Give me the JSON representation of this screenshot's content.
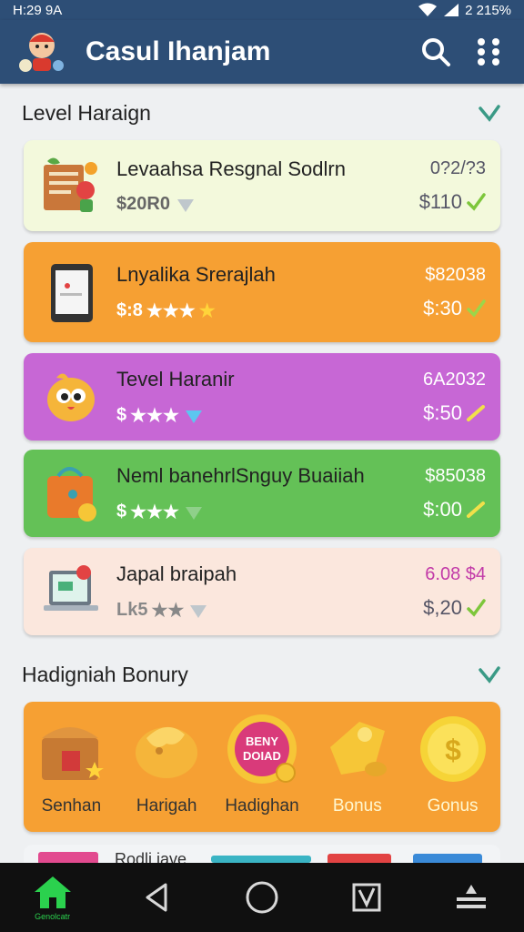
{
  "status": {
    "time": "H:29 9A",
    "battery": "2 215%"
  },
  "app": {
    "title": "Casul Ihanjam",
    "logo_icon": "mascot-logo-icon",
    "search_icon": "search-icon",
    "menu_icon": "more-icon"
  },
  "level_section": {
    "title": "Level Haraign",
    "chevron_icon": "chevron-down-icon"
  },
  "cards": [
    {
      "title": "Levaahsa Resgnal Sodlrn",
      "sub": "$20R0",
      "sub_rating": null,
      "num": "0?2/?3",
      "price": "$110",
      "bg": "#f3f9dc",
      "icon": "clipboard-icon"
    },
    {
      "title": "Lnyalika Srerajlah",
      "sub": "$:8",
      "sub_rating": "★★★",
      "num": "$82038",
      "price": "$:30",
      "bg": "#f6a033",
      "icon": "tablet-icon"
    },
    {
      "title": "Tevel Haranir",
      "sub": "$",
      "sub_rating": "★★★",
      "num": "6A2032",
      "price": "$:50",
      "bg": "#c767d5",
      "icon": "bird-icon"
    },
    {
      "title": "Neml banehrlSnguy Buaiiah",
      "sub": "$",
      "sub_rating": "★★★",
      "num": "$85038",
      "price": "$:00",
      "bg": "#64c157",
      "icon": "bag-icon"
    },
    {
      "title": "Japal braipah",
      "sub": "Lk5",
      "sub_rating": "★★",
      "num": "6.08 $4",
      "price": "$,20",
      "bg": "#fbe7dd",
      "icon": "laptop-icon"
    }
  ],
  "bonus_section": {
    "title": "Hadigniah Bonury",
    "chevron_icon": "chevron-down-icon",
    "items": [
      {
        "label": "Senhan",
        "icon": "treasure-chest-icon",
        "light": false
      },
      {
        "label": "Harigah",
        "icon": "bird-coin-icon",
        "light": false
      },
      {
        "label": "Hadighan",
        "icon": "badge-icon",
        "badge_text": "BENY\nDOIAD",
        "light": false
      },
      {
        "label": "Bonus",
        "icon": "tag-icon",
        "light": true
      },
      {
        "label": "Gonus",
        "icon": "coin-icon",
        "light": true
      }
    ]
  },
  "peek": {
    "text": "Rodli iave"
  },
  "navbar": {
    "home_label": "Genolcatr",
    "home_icon": "home-icon",
    "back_icon": "back-icon",
    "circle_icon": "home-circle-icon",
    "recent_icon": "recent-apps-icon",
    "menu_icon": "menu-lines-icon"
  },
  "colors": {
    "appbar": "#2d4e76",
    "orange": "#f6a033",
    "purple": "#c767d5",
    "green": "#64c157",
    "yellow_check": "#e8d632",
    "green_check": "#7dc63b"
  }
}
